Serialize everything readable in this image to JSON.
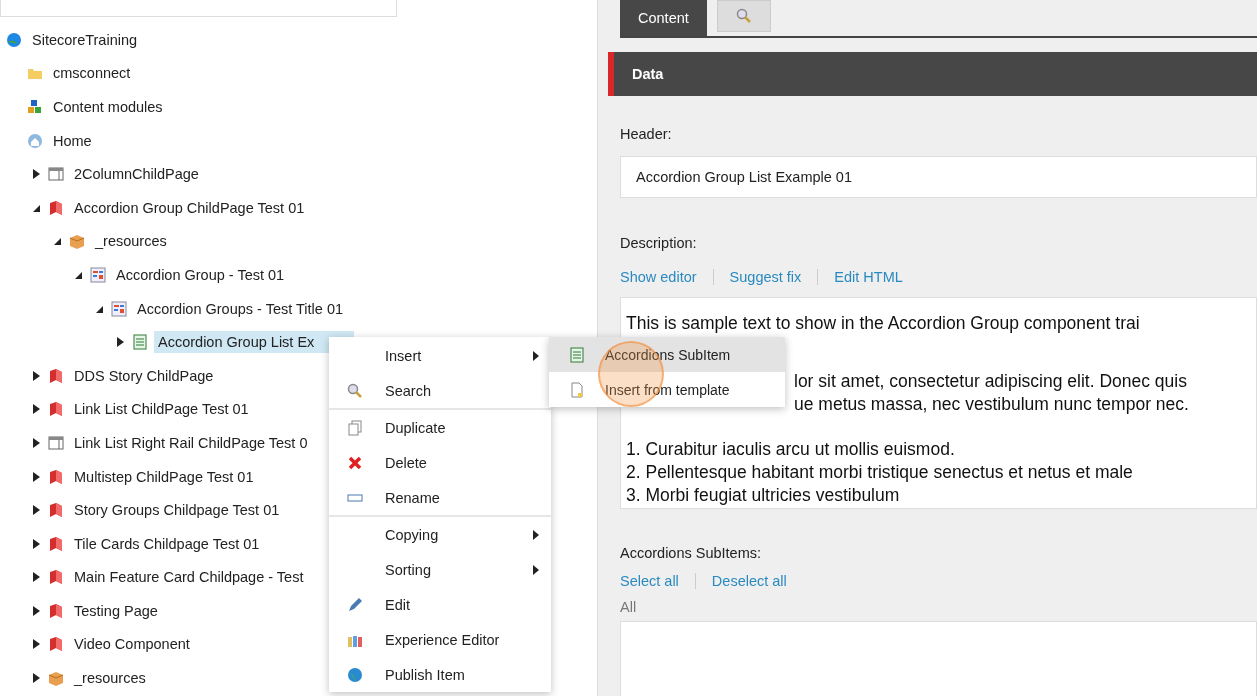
{
  "tree": [
    {
      "label": "SitecoreTraining",
      "kind": "site",
      "selected": false,
      "children": [
        {
          "label": "cmsconnect",
          "kind": "folder",
          "selected": false
        },
        {
          "label": "Content modules",
          "kind": "modules",
          "selected": false
        },
        {
          "label": "Home",
          "kind": "home",
          "selected": false,
          "children": [
            {
              "label": "2ColumnChildPage",
              "kind": "layout",
              "expanded": false,
              "selected": false
            },
            {
              "label": "Accordion Group ChildPage Test 01",
              "kind": "page",
              "expanded": true,
              "selected": false,
              "children": [
                {
                  "label": "_resources",
                  "kind": "box",
                  "expanded": true,
                  "selected": false,
                  "children": [
                    {
                      "label": "Accordion Group - Test 01",
                      "kind": "group",
                      "expanded": true,
                      "selected": false,
                      "children": [
                        {
                          "label": "Accordion Groups - Test Title 01",
                          "kind": "group",
                          "expanded": true,
                          "selected": false,
                          "children": [
                            {
                              "label": "Accordion Group List Ex",
                              "kind": "list",
                              "expanded": false,
                              "selected": true
                            }
                          ]
                        }
                      ]
                    }
                  ]
                }
              ]
            },
            {
              "label": "DDS Story ChildPage",
              "kind": "page",
              "expanded": false,
              "selected": false
            },
            {
              "label": "Link List ChildPage Test 01",
              "kind": "page",
              "expanded": false,
              "selected": false
            },
            {
              "label": "Link List Right Rail ChildPage Test 0",
              "kind": "layout",
              "expanded": false,
              "selected": false
            },
            {
              "label": "Multistep ChildPage Test 01",
              "kind": "page",
              "expanded": false,
              "selected": false
            },
            {
              "label": "Story Groups Childpage Test 01",
              "kind": "page",
              "expanded": false,
              "selected": false
            },
            {
              "label": "Tile Cards Childpage Test 01",
              "kind": "page",
              "expanded": false,
              "selected": false
            },
            {
              "label": "Main Feature Card Childpage - Test",
              "kind": "page",
              "expanded": false,
              "selected": false
            },
            {
              "label": "Testing Page",
              "kind": "page",
              "expanded": false,
              "selected": false
            },
            {
              "label": "Video Component",
              "kind": "page",
              "expanded": false,
              "selected": false
            },
            {
              "label": "_resources",
              "kind": "box",
              "expanded": false,
              "selected": false
            }
          ]
        }
      ]
    }
  ],
  "context_menu": {
    "sections": [
      [
        {
          "label": "Insert",
          "kind": "none",
          "submenu": true
        },
        {
          "label": "Search",
          "kind": "search",
          "submenu": false
        }
      ],
      [
        {
          "label": "Duplicate",
          "kind": "duplicate",
          "submenu": false
        },
        {
          "label": "Delete",
          "kind": "delete",
          "submenu": false
        },
        {
          "label": "Rename",
          "kind": "rename",
          "submenu": false
        }
      ],
      [
        {
          "label": "Copying",
          "kind": "none",
          "submenu": true
        },
        {
          "label": "Sorting",
          "kind": "none",
          "submenu": true
        },
        {
          "label": "Edit",
          "kind": "edit",
          "submenu": false
        },
        {
          "label": "Experience Editor",
          "kind": "experience",
          "submenu": false
        },
        {
          "label": "Publish Item",
          "kind": "publish",
          "submenu": false
        }
      ]
    ]
  },
  "submenu": [
    {
      "label": "Accordions SubItem",
      "kind": "list",
      "selected": true
    },
    {
      "label": "Insert from template",
      "kind": "template",
      "selected": false
    }
  ],
  "tabs": [
    {
      "label": "Content",
      "kind": "text",
      "selected": true
    },
    {
      "kind": "search",
      "selected": false
    }
  ],
  "section": {
    "title": "Data"
  },
  "fields": {
    "header_label": "Header:",
    "header_value": "Accordion Group List Example 01",
    "description_label": "Description:",
    "editor_links": [
      "Show editor",
      "Suggest fix",
      "Edit HTML"
    ],
    "description_lines": [
      {
        "text": "This is sample text to show in the Accordion Group component trai",
        "kind": "line"
      },
      {
        "text": "lor sit amet, consectetur adipiscing elit. Donec quis",
        "kind": "first_continued"
      },
      {
        "text": "ue metus massa, nec vestibulum nunc tempor nec.",
        "kind": "continued"
      },
      {
        "text": "1. Curabitur iaculis arcu ut mollis euismod.",
        "kind": "gap"
      },
      {
        "text": "2. Pellentesque habitant morbi tristique senectus et netus et male",
        "kind": "line"
      },
      {
        "text": "3. Morbi feugiat ultricies vestibulum",
        "kind": "line"
      }
    ],
    "subitems_label": "Accordions SubItems:",
    "select_links": [
      "Select all",
      "Deselect all"
    ],
    "list_placeholder": "All"
  }
}
